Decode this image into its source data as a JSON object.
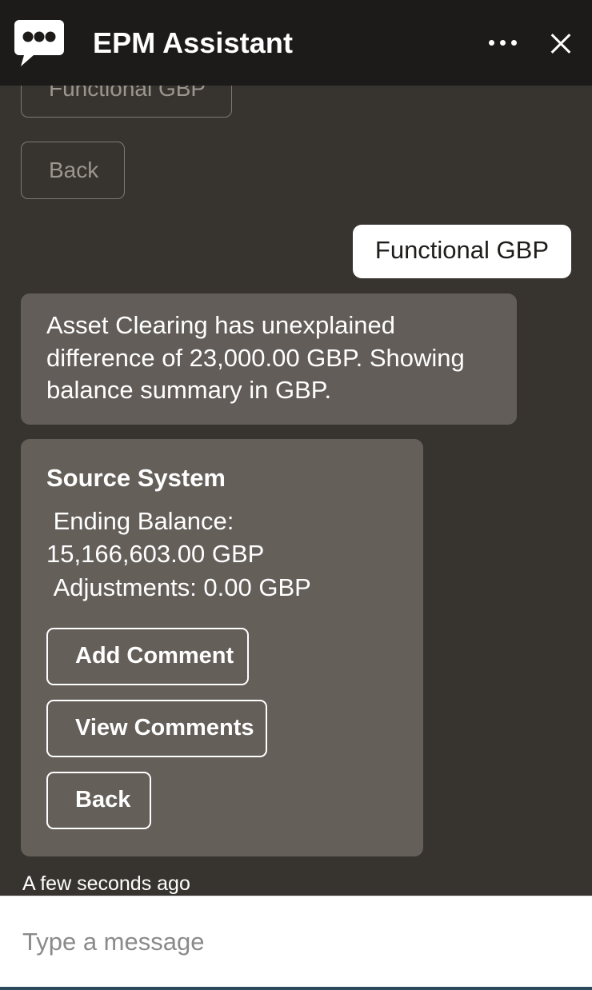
{
  "header": {
    "title": "EPM Assistant",
    "icon": "chat-bubble-icon",
    "menu_label": "•••",
    "menu_icon": "ellipsis-icon",
    "close_icon": "close-icon",
    "background": "#1c1b19",
    "text_color": "#ffffff"
  },
  "theme": {
    "chat_background": "#373430",
    "bot_bubble": "#625d58",
    "card_background": "#655f5a",
    "user_bubble": "#ffffff",
    "accent_underline": "#2d4a5c",
    "muted_text": "#9b968e",
    "muted_border": "#7d7870"
  },
  "chat": {
    "previous_quick_replies": [
      {
        "label": "Functional GBP",
        "state": "dimmed"
      },
      {
        "label": "Back",
        "state": "dimmed"
      }
    ],
    "user_message": {
      "text": "Functional GBP"
    },
    "bot_message": {
      "text": "Asset Clearing has unexplained difference of 23,000.00 GBP. Showing balance summary in GBP."
    },
    "card": {
      "title": "Source System",
      "lines": [
        " Ending Balance: 15,166,603.00 GBP",
        " Adjustments: 0.00 GBP"
      ],
      "buttons": [
        {
          "label": "Add Comment"
        },
        {
          "label": "View Comments"
        },
        {
          "label": "Back"
        }
      ]
    },
    "timestamp": "A few seconds ago"
  },
  "composer": {
    "placeholder": "Type a message",
    "value": ""
  }
}
